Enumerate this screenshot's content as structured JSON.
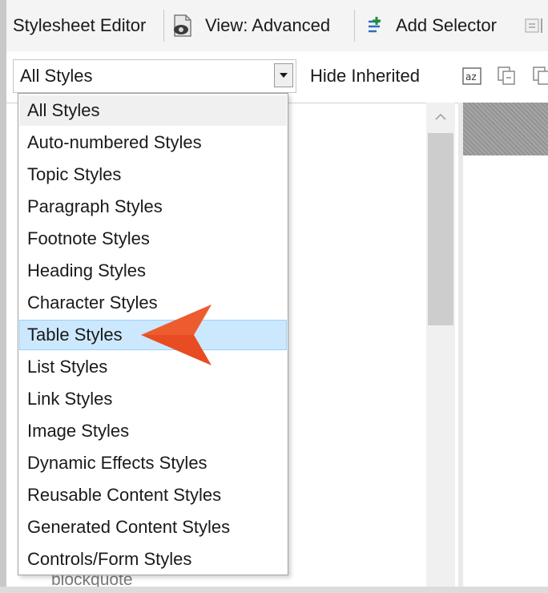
{
  "toolbar": {
    "title": "Stylesheet Editor",
    "view_label": "View: Advanced",
    "add_selector_label": "Add Selector"
  },
  "filter_bar": {
    "combo_value": "All Styles",
    "hide_inherited_label": "Hide Inherited"
  },
  "dropdown": {
    "items": [
      {
        "label": "All Styles"
      },
      {
        "label": "Auto-numbered Styles"
      },
      {
        "label": "Topic Styles"
      },
      {
        "label": "Paragraph Styles"
      },
      {
        "label": "Footnote Styles"
      },
      {
        "label": "Heading Styles"
      },
      {
        "label": "Character Styles"
      },
      {
        "label": "Table Styles"
      },
      {
        "label": "List Styles"
      },
      {
        "label": "Link Styles"
      },
      {
        "label": "Image Styles"
      },
      {
        "label": "Dynamic Effects Styles"
      },
      {
        "label": "Reusable Content Styles"
      },
      {
        "label": "Generated Content Styles"
      },
      {
        "label": "Controls/Form Styles"
      }
    ],
    "selected": "All Styles",
    "highlighted": "Table Styles"
  },
  "background_list": {
    "visible_item": "blockquote"
  },
  "icons": {
    "view": "view-mode-icon",
    "add_selector": "add-selector-icon",
    "sort": "sort-az-icon",
    "copy": "copy-icon",
    "arrow": "pointer-arrow-icon"
  },
  "colors": {
    "highlight_bg": "#cce8ff",
    "highlight_border": "#99d1ff",
    "callout_arrow": "#e84c22",
    "add_selector_green": "#1e8f3a"
  }
}
